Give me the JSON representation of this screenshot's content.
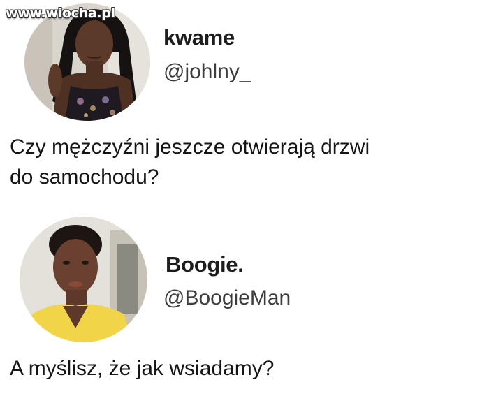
{
  "watermark": "www.wiocha.pl",
  "tweets": [
    {
      "display_name": "kwame",
      "handle": "@johlny_",
      "text": "Czy mężczyźni jeszcze otwierają drzwi\ndo samochodu?",
      "avatar_icon": "profile-photo-woman"
    },
    {
      "display_name": "Boogie.",
      "handle": "@BoogieMan",
      "text": "A myślisz, że jak wsiadamy?",
      "avatar_icon": "profile-photo-man"
    }
  ]
}
